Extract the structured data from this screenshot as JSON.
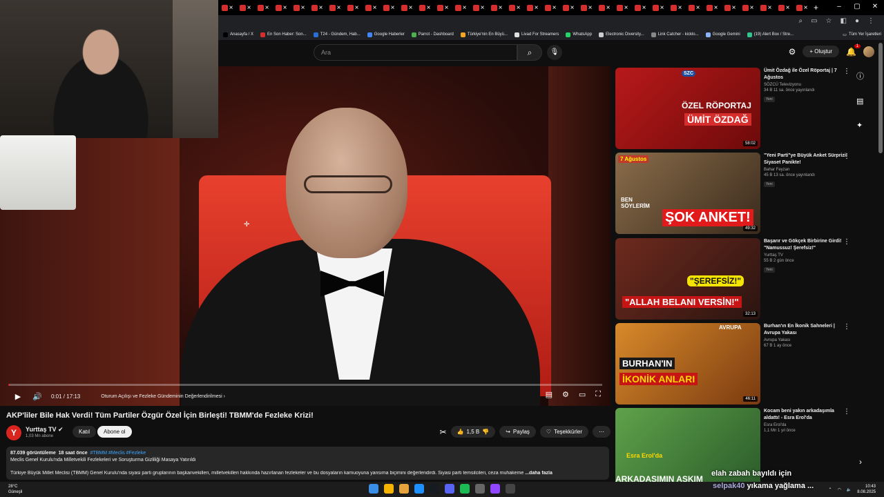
{
  "browser": {
    "tab_count": 33,
    "new_tab_glyph": "+",
    "bookmarks": [
      {
        "label": "Anasayfa / X",
        "color": "#000000"
      },
      {
        "label": "En Son Haber: Son...",
        "color": "#d62d2d"
      },
      {
        "label": "T24 - Gündem, Hab...",
        "color": "#2a6fd6"
      },
      {
        "label": "Google Haberler",
        "color": "#4285f4"
      },
      {
        "label": "Parrot - Dashboard",
        "color": "#4caf50"
      },
      {
        "label": "Türkiye'nin En Büyü...",
        "color": "#f5a623"
      },
      {
        "label": "Livad For Streamers",
        "color": "#e0e0e0"
      },
      {
        "label": "WhatsApp",
        "color": "#25d366"
      },
      {
        "label": "Electronic Diversity...",
        "color": "#cccccc"
      },
      {
        "label": "Link Catcher - kicklo...",
        "color": "#888888"
      },
      {
        "label": "Google Gemini",
        "color": "#8ab4f8"
      },
      {
        "label": "(19) Alert Box / Stre...",
        "color": "#31c48d"
      }
    ],
    "all_bookmarks_label": "Tüm Yer İşaretleri"
  },
  "header": {
    "search_placeholder": "Ara",
    "create_label": "Oluştur",
    "notification_count": "1"
  },
  "player": {
    "time": "0:01 / 17:13",
    "chapter": "Oturum Açılışı ve Fezleke Gündeminin Değerlendirilmesi",
    "progress_fraction": 0.001
  },
  "video": {
    "title": "AKP'liler Bile Hak Verdi! Tüm Partiler Özgür Özel İçin Birleşti! TBMM'de Fezleke Krizi!",
    "channel": "Yurttaş TV",
    "channel_initial": "Y",
    "subscribers": "1,03 Mn abone",
    "join_label": "Katıl",
    "subscribe_label": "Abone ol",
    "likes": "1,5 B",
    "share_label": "Paylaş",
    "thanks_label": "Teşekkürler",
    "more_glyph": "⋯"
  },
  "description": {
    "views": "87.039 görüntüleme",
    "date": "18 saat önce",
    "tags": "#TBMM #Meclis #Fezleke",
    "line2": "Meclis Genel Kurulu'nda Milletvekili Fezlekeleri ve Soruşturma Gizliliği Masaya Yatırıldı",
    "line3": "Türkiye Büyük Millet Meclisi (TBMM) Genel Kurulu'nda siyasi parti gruplarının başkanvekilleri, milletvekilleri hakkında hazırlanan fezlekeler ve bu dosyaların kamuoyuna yansıma biçimini değerlendirdi. Siyasi parti temsilcileri, ceza muhakeme",
    "more_label": "...daha fazla"
  },
  "recommendations": [
    {
      "title": "Ümit Özdağ ile Özel Röportaj | 7 Ağustos",
      "channel": "SÖZCÜ Televizyonu",
      "meta": "34 B  11 sa. önce yayınlandı",
      "badge": "Yeni",
      "duration": "58:02",
      "thumb_text_1": "ÖZEL RÖPORTAJ",
      "thumb_text_2": "ÜMİT ÖZDAĞ",
      "thumb_logo": "SZC"
    },
    {
      "title": "\"Yeni Parti\"ye Büyük Anket Sürprizi! Siyaset Panikte!",
      "channel": "Bahar Feyzan",
      "meta": "45 B  13 sa. önce yayınlandı",
      "badge": "Yeni",
      "duration": "49:32",
      "thumb_text_1": "ŞOK ANKET!",
      "thumb_text_2": "7 Ağustos",
      "thumb_text_3": "BEN SÖYLERİM"
    },
    {
      "title": "Başarır ve Gökçek Birbirine Girdi! \"Namussuz! Şerefsiz!\"",
      "channel": "Yurttaş TV",
      "meta": "55 B  2 gün önce",
      "badge": "Yeni",
      "duration": "32:13",
      "thumb_text_1": "\"ŞEREFSİZ!\"",
      "thumb_text_2": "\"ALLAH BELANI VERSİN!\""
    },
    {
      "title": "Burhan'ın En İkonik Sahneleri | Avrupa Yakası",
      "channel": "Avrupa Yakası",
      "meta": "67 B  1 ay önce",
      "badge": "",
      "duration": "46:11",
      "thumb_text_1": "BURHAN'IN",
      "thumb_text_2": "İKONİK ANLARI",
      "thumb_text_3": "AVRUPA"
    },
    {
      "title": "Kocam beni yakın arkadaşımla aldattı! - Esra Erol'da",
      "channel": "Esra Erol'da",
      "meta": "1,1 Mn  1 yıl önce",
      "badge": "",
      "duration": "",
      "thumb_text_1": "ARKADAŞIMIN AŞKIM",
      "thumb_text_2": "Esra Erol'da"
    }
  ],
  "chat_overlay": {
    "line1": "elah zabah bayıldı için",
    "user": "selpak40",
    "line2": "yıkama yağlama ..."
  },
  "taskbar": {
    "temp": "28°C",
    "weather": "Güneşli",
    "time": "10:43",
    "date": "8.08.2025"
  }
}
